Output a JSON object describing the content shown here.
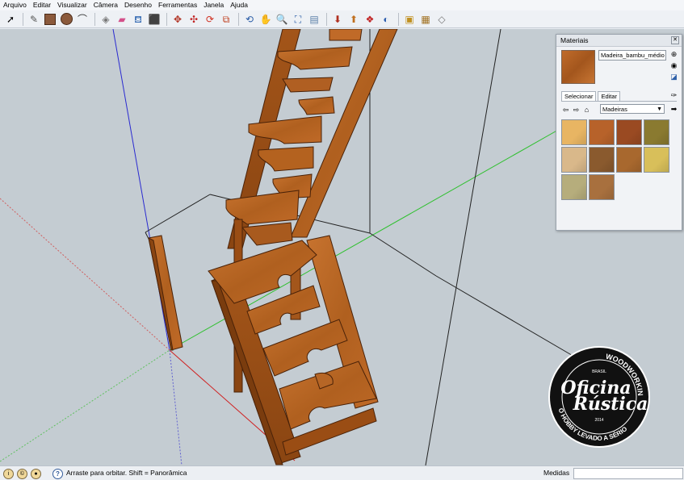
{
  "menu": [
    "Arquivo",
    "Editar",
    "Visualizar",
    "Câmera",
    "Desenho",
    "Ferramentas",
    "Janela",
    "Ajuda"
  ],
  "toolbar_icons": [
    "select-tool",
    "pencil-tool",
    "rectangle-tool",
    "circle-tool",
    "arc-tool",
    "make-component-tool",
    "eraser-tool",
    "paint-bucket-tool",
    "push-pull-tool",
    "move-tool",
    "rotate-tool",
    "follow-me-tool",
    "scale-tool",
    "orbit-tool",
    "pan-tool",
    "zoom-tool",
    "zoom-extents-tool",
    "previous-view-tool",
    "get-models-tool",
    "share-model-tool",
    "component-warehouse-tool",
    "extension-warehouse-tool",
    "layout-tool",
    "styles-tool"
  ],
  "materials_panel": {
    "title": "Materiais",
    "material_name": "Madeira_bambu_médio",
    "tabs": [
      "Selecionar",
      "Editar"
    ],
    "collection": "Madeiras",
    "swatch_colors": [
      "#e8b563",
      "#b7622a",
      "#9a4a22",
      "#8a7a30",
      "#d9b88a",
      "#8a5a2e",
      "#a8682e",
      "#d8bf5a",
      "#b6ad7c",
      "#a8703e"
    ]
  },
  "watermark": {
    "top": "WOODWORKING",
    "country": "BRASIL",
    "line1": "Oficina",
    "line2": "Rústica",
    "year": "2014",
    "bottom": "O HOBBY LEVADO A SÉRIO"
  },
  "status": {
    "text": "Arraste para orbitar. Shift = Panorâmica",
    "measures_label": "Medidas"
  }
}
